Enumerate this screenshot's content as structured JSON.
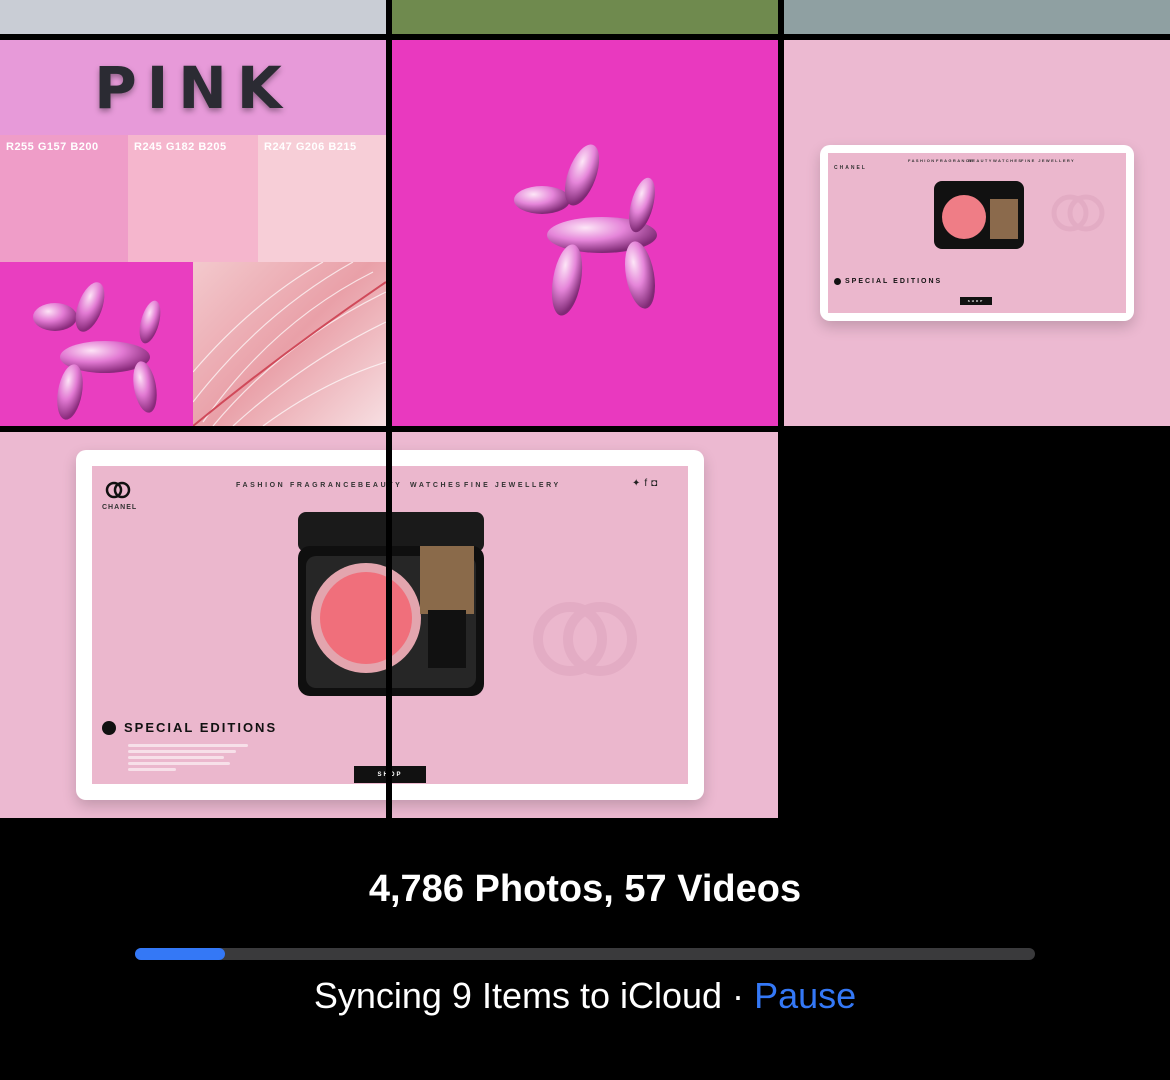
{
  "grid": {
    "swatches": [
      {
        "label": "R255 G157 B200",
        "color": "#ef9dc8"
      },
      {
        "label": "R245 G182 B205",
        "color": "#f5b6cd"
      },
      {
        "label": "R247 G206 B215",
        "color": "#f7ced7"
      }
    ],
    "pink_title": "PINK",
    "brand": "CHANEL",
    "nav_items": [
      "FASHION",
      "FRAGRANCE",
      "BEAUTY",
      "WATCHES",
      "FINE JEWELLERY"
    ],
    "section_title": "SPECIAL EDITIONS",
    "shop_label": "SHOP",
    "compact_brand": "CHANEL"
  },
  "library": {
    "count_text": "4,786 Photos, 57 Videos",
    "sync_text": "Syncing 9 Items to iCloud · ",
    "pause_label": "Pause",
    "progress": 0.1
  },
  "colors": {
    "accent": "#3478f6",
    "hot_pink": "#e939bf",
    "soft_pink": "#ecb9d1"
  }
}
